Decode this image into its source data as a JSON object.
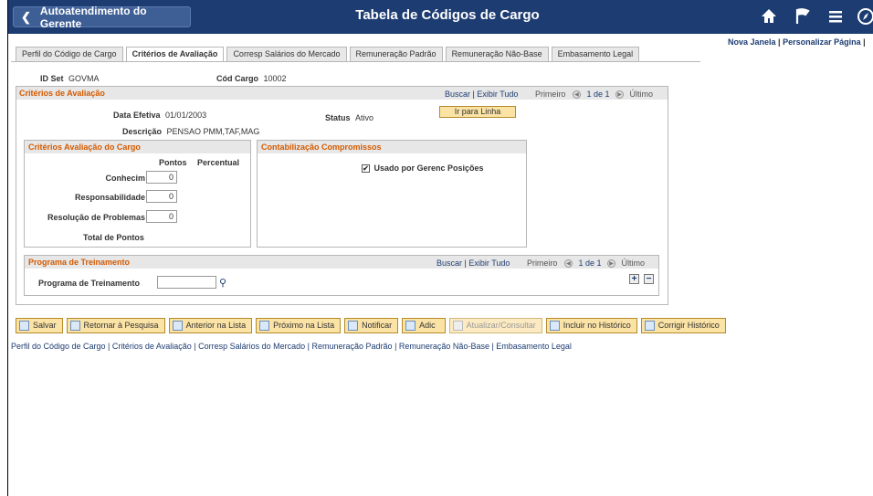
{
  "header": {
    "back_label": "Autoatendimento do Gerente",
    "title": "Tabela de Códigos de Cargo",
    "icons": [
      "home-icon",
      "flag-icon",
      "menu-icon",
      "compass-icon"
    ]
  },
  "top_links": {
    "new_window": "Nova Janela",
    "separator": "|",
    "personalize": "Personalizar Página",
    "separator2": "|"
  },
  "tabs": [
    {
      "label": "Perfil do Código de Cargo"
    },
    {
      "label": "Critérios de Avaliação",
      "active": true
    },
    {
      "label": "Corresp Salários do Mercado"
    },
    {
      "label": "Remuneração Padrão"
    },
    {
      "label": "Remuneração Não-Base"
    },
    {
      "label": "Embasamento Legal"
    }
  ],
  "id_line": {
    "setid_label": "ID Set",
    "setid_value": "GOVMA",
    "job_label": "Cód Cargo",
    "job_value": "10002"
  },
  "criteria": {
    "title": "Critérios de Avaliação",
    "find": "Buscar",
    "sep": "|",
    "view_all": "Exibir Tudo",
    "first": "Primeiro",
    "counter": "1 de 1",
    "last": "Último",
    "eff_date_label": "Data Efetiva",
    "eff_date_value": "01/01/2003",
    "status_label": "Status",
    "status_value": "Ativo",
    "goto_row": "Ir para Linha",
    "desc_label": "Descrição",
    "desc_value": "PENSAO PMM,TAF,MAG"
  },
  "eval": {
    "title": "Critérios Avaliação do Cargo",
    "col_points": "Pontos",
    "col_percent": "Percentual",
    "rows": [
      {
        "label": "Conhecim",
        "value": "0"
      },
      {
        "label": "Responsabilidade",
        "value": "0"
      },
      {
        "label": "Resolução de Problemas",
        "value": "0"
      }
    ],
    "total_label": "Total de Pontos"
  },
  "commit": {
    "title": "Contabilização Compromissos",
    "checkbox_label": "Usado por Gerenc Posições",
    "checked": true
  },
  "training": {
    "title": "Programa de Treinamento",
    "find": "Buscar",
    "sep": "|",
    "view_all": "Exibir Tudo",
    "first": "Primeiro",
    "counter": "1 de 1",
    "last": "Último",
    "field_label": "Programa de Treinamento",
    "field_value": ""
  },
  "toolbar": [
    {
      "label": "Salvar",
      "icon": "save-icon"
    },
    {
      "label": "Retornar à Pesquisa",
      "icon": "return-icon"
    },
    {
      "label": "Anterior na Lista",
      "icon": "previous-icon"
    },
    {
      "label": "Próximo na Lista",
      "icon": "next-icon"
    },
    {
      "label": "Notificar",
      "icon": "notify-icon"
    },
    {
      "label": "Adic",
      "icon": "add-icon"
    },
    {
      "label": "Atualizar/Consultar",
      "icon": "update-icon",
      "disabled": true
    },
    {
      "label": "Incluir no Histórico",
      "icon": "include-history-icon"
    },
    {
      "label": "Corrigir Histórico",
      "icon": "correct-history-icon"
    }
  ],
  "bottom_links": "Perfil do Código de Cargo | Critérios de Avaliação | Corresp Salários do Mercado | Remuneração Padrão | Remuneração Não-Base | Embasamento Legal",
  "colors": {
    "header_bg": "#1d3c72",
    "section_title": "#d45a00",
    "button_bg": "#fbe3a6"
  }
}
